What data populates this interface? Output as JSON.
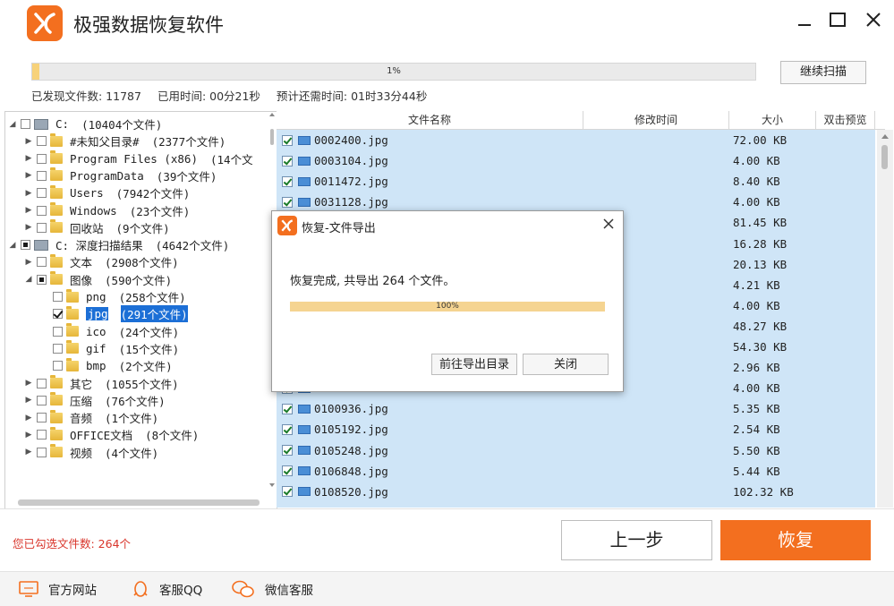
{
  "app": {
    "title": "极强数据恢复软件"
  },
  "scan": {
    "progress_text": "1%",
    "progress_value": 0.01,
    "continue_label": "继续扫描",
    "files_found": "已发现文件数: 11787",
    "elapsed": "已用时间: 00分21秒",
    "remaining": "预计还需时间: 01时33分44秒"
  },
  "tree": [
    {
      "level": 0,
      "label": "C:",
      "count": "(10404个文件)",
      "type": "drive",
      "check": "none",
      "expanded": true
    },
    {
      "level": 1,
      "label": "#未知父目录#",
      "count": "(2377个文件)",
      "type": "folder",
      "check": "none"
    },
    {
      "level": 1,
      "label": "Program Files (x86)",
      "count": "(14个文",
      "type": "folder",
      "check": "none"
    },
    {
      "level": 1,
      "label": "ProgramData",
      "count": "(39个文件)",
      "type": "folder",
      "check": "none"
    },
    {
      "level": 1,
      "label": "Users",
      "count": "(7942个文件)",
      "type": "folder",
      "check": "none"
    },
    {
      "level": 1,
      "label": "Windows",
      "count": "(23个文件)",
      "type": "folder",
      "check": "none"
    },
    {
      "level": 1,
      "label": "回收站",
      "count": "(9个文件)",
      "type": "folder",
      "check": "none"
    },
    {
      "level": 0,
      "label": "C: 深度扫描结果",
      "count": "(4642个文件)",
      "type": "drive",
      "check": "partial",
      "expanded": true
    },
    {
      "level": 1,
      "label": "文本",
      "count": "(2908个文件)",
      "type": "folder",
      "check": "none"
    },
    {
      "level": 1,
      "label": "图像",
      "count": "(590个文件)",
      "type": "folder",
      "check": "partial",
      "expanded": true
    },
    {
      "level": 2,
      "label": "png",
      "count": "(258个文件)",
      "type": "folder",
      "check": "none"
    },
    {
      "level": 2,
      "label": "jpg",
      "count": "(291个文件)",
      "type": "folder",
      "check": "checked",
      "selected": true
    },
    {
      "level": 2,
      "label": "ico",
      "count": "(24个文件)",
      "type": "folder",
      "check": "none"
    },
    {
      "level": 2,
      "label": "gif",
      "count": "(15个文件)",
      "type": "folder",
      "check": "none"
    },
    {
      "level": 2,
      "label": "bmp",
      "count": "(2个文件)",
      "type": "folder",
      "check": "none"
    },
    {
      "level": 1,
      "label": "其它",
      "count": "(1055个文件)",
      "type": "folder",
      "check": "none"
    },
    {
      "level": 1,
      "label": "压缩",
      "count": "(76个文件)",
      "type": "folder",
      "check": "none"
    },
    {
      "level": 1,
      "label": "音频",
      "count": "(1个文件)",
      "type": "folder",
      "check": "none"
    },
    {
      "level": 1,
      "label": "OFFICE文档",
      "count": "(8个文件)",
      "type": "folder",
      "check": "none"
    },
    {
      "level": 1,
      "label": "视频",
      "count": "(4个文件)",
      "type": "folder",
      "check": "none"
    }
  ],
  "list": {
    "columns": [
      "文件名称",
      "修改时间",
      "大小",
      "双击预览"
    ],
    "rows": [
      {
        "name": "0002400.jpg",
        "size": "72.00 KB"
      },
      {
        "name": "0003104.jpg",
        "size": "4.00 KB"
      },
      {
        "name": "0011472.jpg",
        "size": "8.40 KB"
      },
      {
        "name": "0031128.jpg",
        "size": "4.00 KB"
      },
      {
        "name": "",
        "size": "81.45 KB"
      },
      {
        "name": "",
        "size": "16.28 KB"
      },
      {
        "name": "",
        "size": "20.13 KB"
      },
      {
        "name": "",
        "size": "4.21 KB"
      },
      {
        "name": "",
        "size": "4.00 KB"
      },
      {
        "name": "",
        "size": "48.27 KB"
      },
      {
        "name": "",
        "size": "54.30 KB"
      },
      {
        "name": "",
        "size": "2.96 KB"
      },
      {
        "name": "",
        "size": "4.00 KB"
      },
      {
        "name": "0100936.jpg",
        "size": "5.35 KB"
      },
      {
        "name": "0105192.jpg",
        "size": "2.54 KB"
      },
      {
        "name": "0105248.jpg",
        "size": "5.50 KB"
      },
      {
        "name": "0106848.jpg",
        "size": "5.44 KB"
      },
      {
        "name": "0108520.jpg",
        "size": "102.32 KB"
      }
    ]
  },
  "dialog": {
    "title": "恢复-文件导出",
    "message": "恢复完成, 共导出 264 个文件。",
    "progress_text": "100%",
    "progress_value": 1.0,
    "open_dir_label": "前往导出目录",
    "close_label": "关闭"
  },
  "bottom": {
    "selected_count": "您已勾选文件数: 264个",
    "prev_label": "上一步",
    "recover_label": "恢复"
  },
  "footer": {
    "website": "官方网站",
    "qq": "客服QQ",
    "wechat": "微信客服"
  },
  "colors": {
    "accent": "#f36f1f",
    "selection": "#1c6fd6",
    "list_bg": "#cfe5f7",
    "progress": "#f7d27a"
  }
}
